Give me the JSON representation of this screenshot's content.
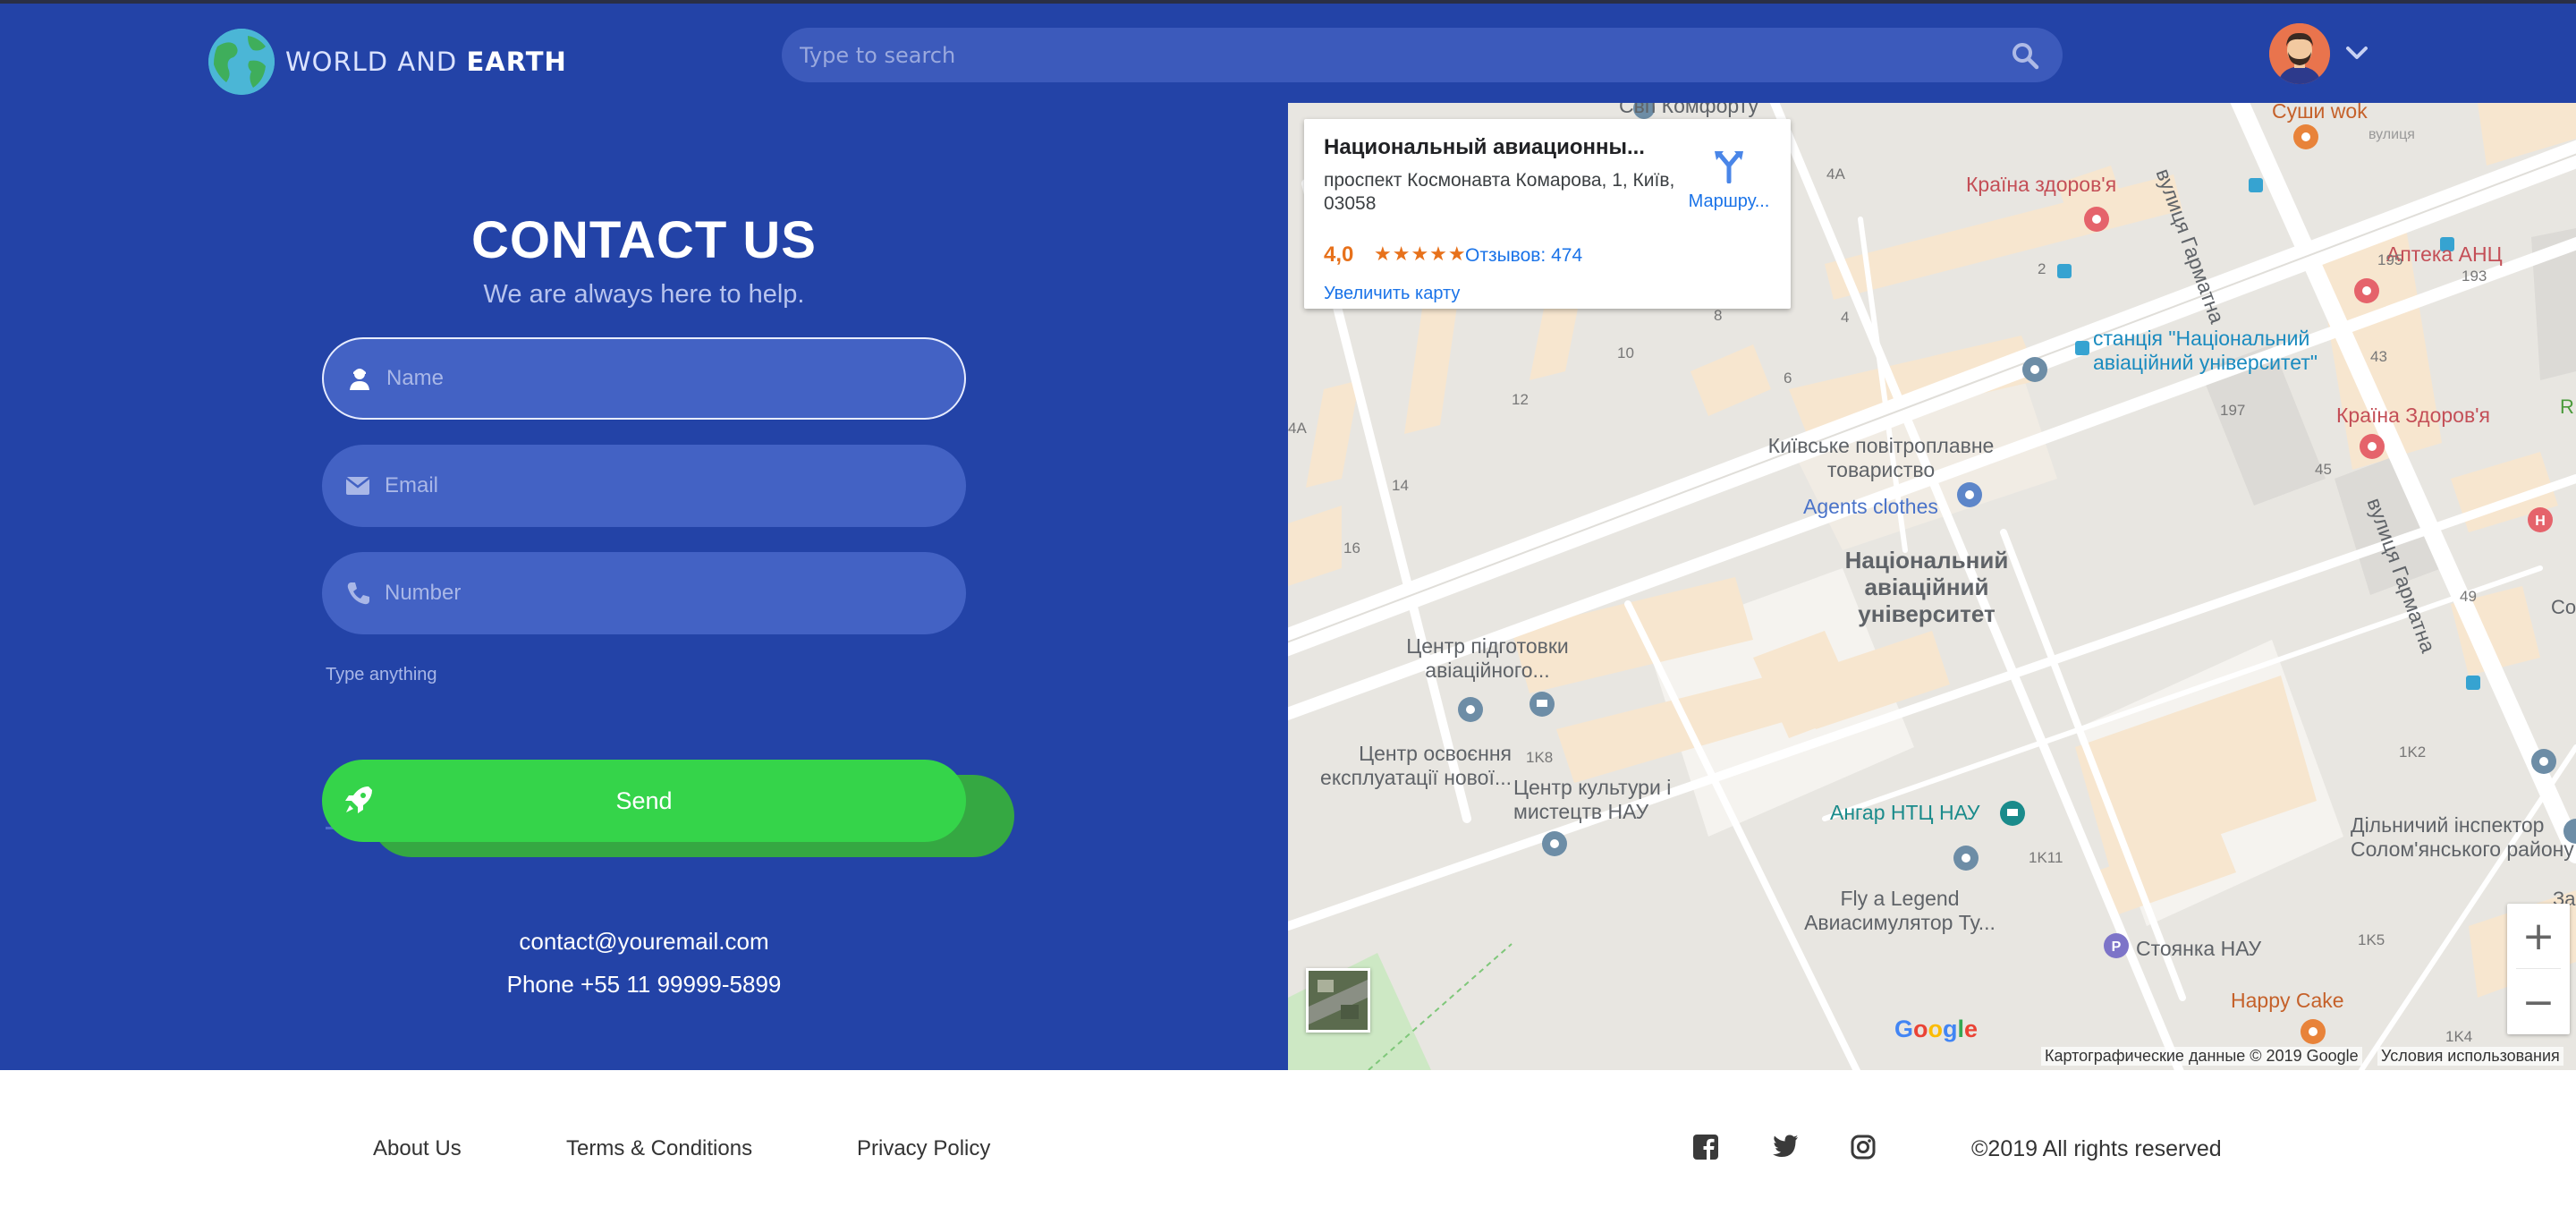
{
  "header": {
    "logo_prefix": "WORLD AND ",
    "logo_bold": "EARTH",
    "search_placeholder": "Type to search"
  },
  "contact": {
    "title": "CONTACT US",
    "subtitle": "We are always here to help.",
    "name_placeholder": "Name",
    "email_placeholder": "Email",
    "number_placeholder": "Number",
    "message_placeholder": "Type anything",
    "send_label": "Send",
    "email": "contact@youremail.com",
    "phone": "Phone +55 11 99999-5899"
  },
  "map": {
    "card": {
      "title": "Национальный авиационны...",
      "address": "проспект Космонавта Комарова, 1, Київ, 03058",
      "rating": "4,0",
      "stars": "★★★★★",
      "reviews": "Отзывов: 474",
      "route": "Маршру...",
      "enlarge": "Увеличить карту"
    },
    "labels": [
      {
        "text": "Свп Комфорту",
        "color": "#5f6368"
      },
      {
        "text": "Суши wok",
        "color": "#c5612a"
      },
      {
        "text": "Країна здоров'я",
        "color": "#c44f57"
      },
      {
        "text": "Аптека АНЦ",
        "color": "#c44f57"
      },
      {
        "text": "станція \"Національний авіаційний університет\"",
        "color": "#1a8bbf"
      },
      {
        "text": "Країна Здоров'я",
        "color": "#c44f57"
      },
      {
        "text": "Київське повітроплавне товариство",
        "color": "#5f6368"
      },
      {
        "text": "Agents clothes",
        "color": "#4a73c9"
      },
      {
        "text": "Національний авіаційний університет",
        "color": "#5f6368"
      },
      {
        "text": "Центр підготовки авіаційного...",
        "color": "#5f6368"
      },
      {
        "text": "Центр освоєння експлуатації нової...",
        "color": "#5f6368"
      },
      {
        "text": "Центр культури і мистецтв НАУ",
        "color": "#5f6368"
      },
      {
        "text": "Ангар НТЦ НАУ",
        "color": "#1a8b8b"
      },
      {
        "text": "Fly a Legend Авиасимулятор Ту...",
        "color": "#5f6368"
      },
      {
        "text": "Стоянка НАУ",
        "color": "#5f6368"
      },
      {
        "text": "Happy Cake",
        "color": "#c5612a"
      },
      {
        "text": "Дільничий інспектор Солом'янського району",
        "color": "#5f6368"
      },
      {
        "text": "вулиця Гарматна",
        "color": "#5f6368"
      },
      {
        "text": "вулиця Гарматна",
        "color": "#5f6368"
      }
    ],
    "numbers": [
      "4A",
      "2",
      "195",
      "193",
      "4",
      "43",
      "10",
      "6",
      "12",
      "197",
      "45",
      "14",
      "4A",
      "16",
      "49",
      "1K8",
      "1K2",
      "1K11",
      "1K5",
      "1K4",
      "8",
      "Co",
      "За",
      "R"
    ],
    "google": "Google",
    "attribution": "Картографические данные © 2019 Google",
    "terms": "Условия использования"
  },
  "footer": {
    "about": "About Us",
    "terms": "Terms & Conditions",
    "privacy": "Privacy Policy",
    "copyright": "©2019 All rights reserved"
  }
}
